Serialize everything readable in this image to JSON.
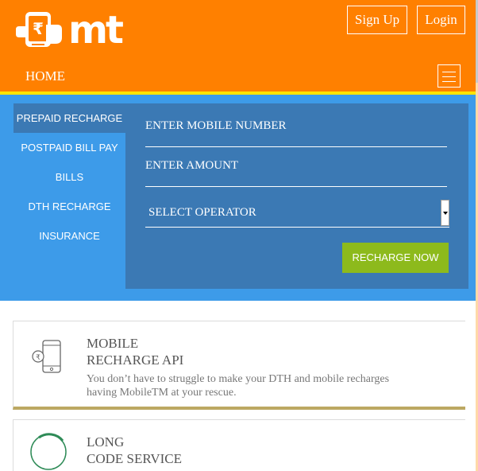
{
  "header": {
    "logo_text": "mt",
    "signup_label": "Sign Up",
    "login_label": "Login",
    "nav_home": "HOME",
    "colors": {
      "header_bg": "#ff8000",
      "stripe": "#ffe400"
    }
  },
  "recharge_panel": {
    "tabs": [
      {
        "label": "PREPAID RECHARGE",
        "active": true
      },
      {
        "label": "POSTPAID BILL PAY",
        "active": false
      },
      {
        "label": "BILLS",
        "active": false
      },
      {
        "label": "DTH RECHARGE",
        "active": false
      },
      {
        "label": "INSURANCE",
        "active": false
      }
    ],
    "mobile_placeholder": "ENTER MOBILE NUMBER",
    "amount_placeholder": "ENTER AMOUNT",
    "operator_select": "SELECT OPERATOR",
    "recharge_button": "RECHARGE NOW",
    "colors": {
      "panel_bg": "#3d9be9",
      "form_bg": "#3b79b4",
      "button": "#8dba1c"
    }
  },
  "services": [
    {
      "title_line1": "MOBILE",
      "title_line2": "RECHARGE API",
      "description": "You don’t have to struggle to make your DTH and mobile recharges having MobileTM at your rescue.",
      "icon": "phone-rupee-icon"
    },
    {
      "title_line1": "LONG",
      "title_line2": "CODE SERVICE",
      "icon": "ring-icon"
    }
  ]
}
